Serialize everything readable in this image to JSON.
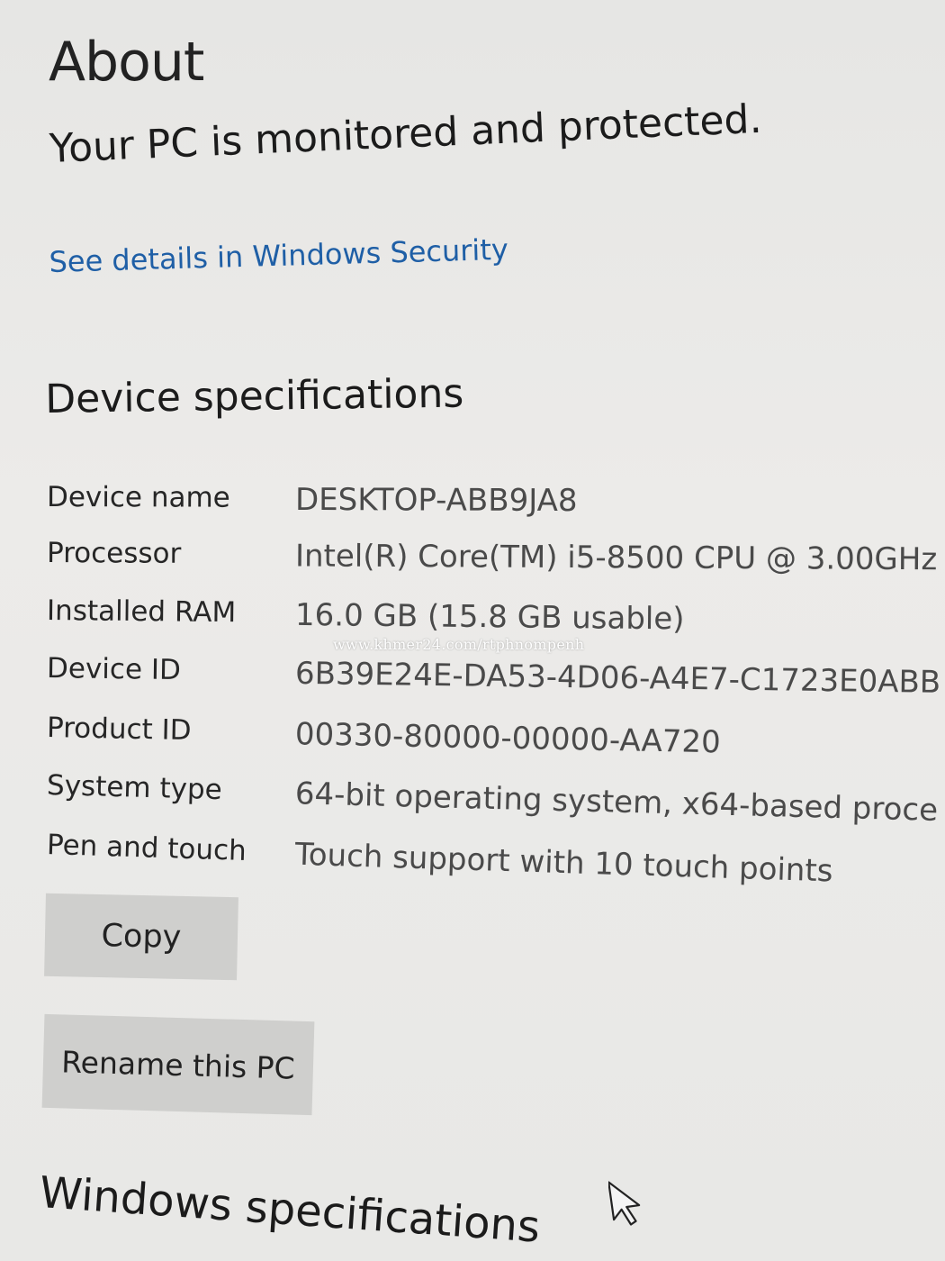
{
  "about": {
    "title": "About",
    "protection_status": "Your PC is monitored and protected.",
    "security_link": "See details in Windows Security"
  },
  "device_specifications": {
    "heading": "Device specifications",
    "rows": [
      {
        "label": "Device name",
        "value": "DESKTOP-ABB9JA8"
      },
      {
        "label": "Processor",
        "value": "Intel(R) Core(TM) i5-8500 CPU @ 3.00GHz"
      },
      {
        "label": "Installed RAM",
        "value": "16.0 GB (15.8 GB usable)"
      },
      {
        "label": "Device ID",
        "value": "6B39E24E-DA53-4D06-A4E7-C1723E0ABB"
      },
      {
        "label": "Product ID",
        "value": "00330-80000-00000-AA720"
      },
      {
        "label": "System type",
        "value": "64-bit operating system, x64-based proce"
      },
      {
        "label": "Pen and touch",
        "value": "Touch support with 10 touch points"
      }
    ],
    "copy_button": "Copy",
    "rename_button": "Rename this PC"
  },
  "windows_specifications": {
    "heading": "Windows specifications"
  },
  "watermark": "www.khmer24.com/rtphnompenh",
  "colors": {
    "link": "#1f5fa6",
    "button_bg": "#cfcfcd",
    "background": "#e9e9e7"
  }
}
